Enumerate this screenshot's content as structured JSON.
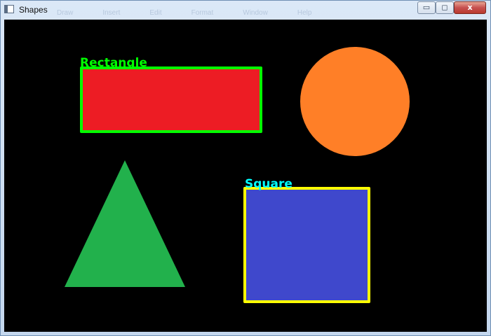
{
  "window": {
    "title": "Shapes",
    "controls": {
      "minimize_glyph": "▭",
      "maximize_glyph": "◻",
      "close_glyph": "x"
    },
    "ghost_menu": [
      "Draw",
      "Insert",
      "Edit",
      "Format",
      "Window",
      "Help"
    ]
  },
  "canvas": {
    "background": "#000000",
    "shapes": {
      "rectangle": {
        "label": "Rectangle",
        "label_color": "#00ff00",
        "fill": "#ed1c24",
        "outline": "#00ff00"
      },
      "circle": {
        "fill": "#ff7f27"
      },
      "triangle": {
        "fill": "#22b14c"
      },
      "square": {
        "label": "Square",
        "label_color": "#00ffff",
        "fill": "#3f48cc",
        "outline": "#ffff00"
      }
    }
  }
}
